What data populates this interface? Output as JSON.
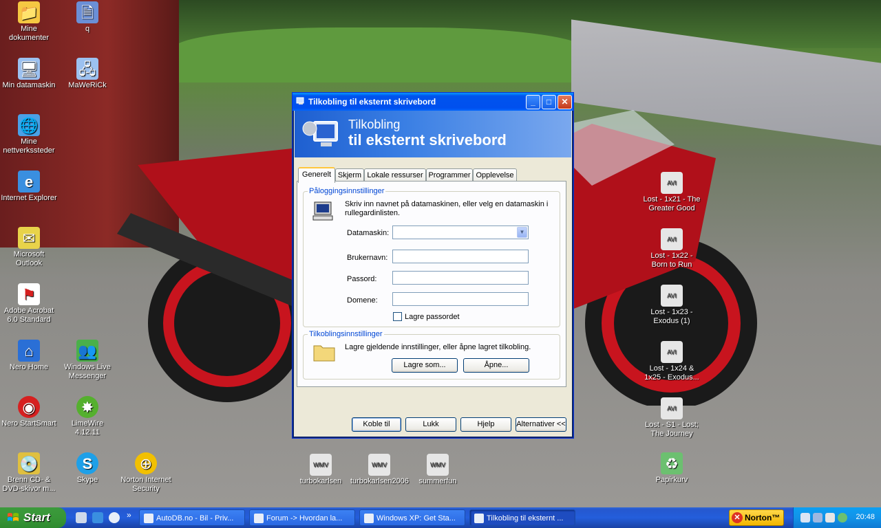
{
  "desktop_icons": [
    {
      "label": "Mine dokumenter",
      "icon": "folder-documents-icon",
      "color": "#f5c842"
    },
    {
      "label": "q",
      "icon": "document-icon",
      "color": "#6b8fd6"
    },
    {
      "label": "Min datamaskin",
      "icon": "computer-icon",
      "color": "#9cc1f0"
    },
    {
      "label": "MaWeRiCk",
      "icon": "network-computer-icon",
      "color": "#9cc1f0"
    },
    {
      "label": "Mine nettverkssteder",
      "icon": "network-places-icon",
      "color": "#4aa0e6"
    },
    {
      "label": "Internet Explorer",
      "icon": "internet-explorer-icon",
      "color": "#3a8fe0"
    },
    {
      "label": "Microsoft Outlook",
      "icon": "outlook-icon",
      "color": "#e8d34a"
    },
    {
      "label": "Adobe Acrobat 6.0 Standard",
      "icon": "acrobat-icon",
      "color": "#d62020"
    },
    {
      "label": "Nero Home",
      "icon": "nero-home-icon",
      "color": "#2a6fd6"
    },
    {
      "label": "Windows Live Messenger",
      "icon": "messenger-icon",
      "color": "#4ab04a"
    },
    {
      "label": "Nero StartSmart",
      "icon": "nero-startsmart-icon",
      "color": "#d62020"
    },
    {
      "label": "LimeWire 4.12.11",
      "icon": "limewire-icon",
      "color": "#55b02e"
    },
    {
      "label": "Brenn CD- & DVD-skivor m...",
      "icon": "burn-cd-icon",
      "color": "#e0c040"
    },
    {
      "label": "Skype",
      "icon": "skype-icon",
      "color": "#1ea0e8"
    },
    {
      "label": "Norton Internet Security",
      "icon": "norton-icon",
      "color": "#f2c000"
    },
    {
      "label": "turbokarlsen",
      "icon": "wmv-file-icon",
      "color": "#e6e6e6"
    },
    {
      "label": "turbokarlsen2006",
      "icon": "wmv-file-icon",
      "color": "#e6e6e6"
    },
    {
      "label": "summerfun",
      "icon": "wmv-file-icon",
      "color": "#e6e6e6"
    },
    {
      "label": "Lost - 1x21 - The Greater Good",
      "icon": "avi-file-icon",
      "color": "#e6e6e6"
    },
    {
      "label": "Lost - 1x22 - Born to Run",
      "icon": "avi-file-icon",
      "color": "#e6e6e6"
    },
    {
      "label": "Lost - 1x23 - Exodus (1)",
      "icon": "avi-file-icon",
      "color": "#e6e6e6"
    },
    {
      "label": "Lost - 1x24 & 1x25 - Exodus...",
      "icon": "avi-file-icon",
      "color": "#e6e6e6"
    },
    {
      "label": "Lost - S1 - Lost; The Journey",
      "icon": "avi-file-icon",
      "color": "#e6e6e6"
    },
    {
      "label": "Papirkurv",
      "icon": "recycle-bin-icon",
      "color": "#6cc070"
    }
  ],
  "dialog": {
    "title": "Tilkobling til eksternt skrivebord",
    "banner_line1": "Tilkobling",
    "banner_line2": "til eksternt skrivebord",
    "tabs": [
      "Generelt",
      "Skjerm",
      "Lokale ressurser",
      "Programmer",
      "Opplevelse"
    ],
    "active_tab": "Generelt",
    "logon_group": {
      "title": "Påloggingsinnstillinger",
      "description": "Skriv inn navnet på datamaskinen, eller velg en datamaskin i rullegardinlisten.",
      "computer_label": "Datamaskin:",
      "computer_value": "",
      "username_label": "Brukernavn:",
      "username_value": "",
      "password_label": "Passord:",
      "password_value": "",
      "domain_label": "Domene:",
      "domain_value": "",
      "save_password_label": "Lagre passordet",
      "save_password_checked": false
    },
    "connection_group": {
      "title": "Tilkoblingsinnstillinger",
      "description": "Lagre gjeldende innstillinger, eller åpne lagret tilkobling.",
      "save_as_label": "Lagre som...",
      "open_label": "Åpne..."
    },
    "buttons": {
      "connect": "Koble til",
      "close": "Lukk",
      "help": "Hjelp",
      "options": "Alternativer <<"
    }
  },
  "taskbar": {
    "start_label": "Start",
    "quick_launch_more": "»",
    "tasks": [
      {
        "label": "AutoDB.no - Bil - Priv...",
        "active": false
      },
      {
        "label": "Forum -> Hvordan la...",
        "active": false
      },
      {
        "label": "Windows XP: Get Sta...",
        "active": false
      },
      {
        "label": "Tilkobling til eksternt ...",
        "active": true
      }
    ],
    "norton_label": "Norton™",
    "clock": "20:48"
  }
}
